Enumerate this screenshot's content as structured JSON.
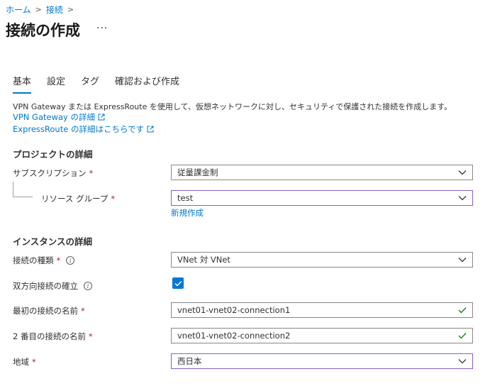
{
  "breadcrumb": {
    "home": "ホーム",
    "connections": "接続",
    "sep": ">"
  },
  "page": {
    "title": "接続の作成",
    "more": "···"
  },
  "tabs": [
    {
      "label": "基本",
      "active": true
    },
    {
      "label": "設定"
    },
    {
      "label": "タグ"
    },
    {
      "label": "確認および作成"
    }
  ],
  "description": "VPN Gateway または ExpressRoute を使用して、仮想ネットワークに対し、セキュリティで保護された接続を作成します。",
  "links": {
    "vpn_gateway": "VPN Gateway の詳細",
    "expressroute": "ExpressRoute の詳細はこちらです"
  },
  "project": {
    "title": "プロジェクトの詳細",
    "subscription": {
      "label": "サブスクリプション",
      "value": "従量課金制"
    },
    "resource_group": {
      "label": "リソース グループ",
      "value": "test",
      "new_link": "新規作成"
    }
  },
  "instance": {
    "title": "インスタンスの詳細",
    "connection_type": {
      "label": "接続の種類",
      "value": "VNet 対 VNet"
    },
    "bidirectional": {
      "label": "双方向接続の確立",
      "checked": true
    },
    "first_name": {
      "label": "最初の接続の名前",
      "value": "vnet01-vnet02-connection1"
    },
    "second_name": {
      "label": "2 番目の接続の名前",
      "value": "vnet01-vnet02-connection2"
    },
    "region": {
      "label": "地域",
      "value": "西日本"
    }
  },
  "required_marker": "*",
  "info_glyph": "i",
  "colors": {
    "accent": "#0078d4",
    "required": "#a4262c",
    "valid": "#107c10",
    "focus_border": "#8661c5"
  }
}
